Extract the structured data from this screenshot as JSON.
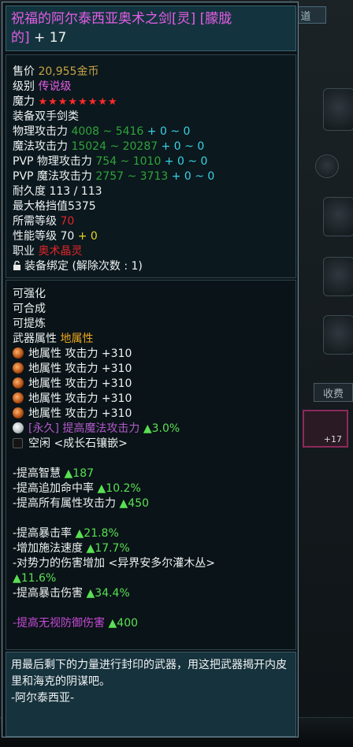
{
  "background": {
    "top_button": "道",
    "charge_button": "收费",
    "item_plus": "+17"
  },
  "title": {
    "line1": "祝福的阿尔泰西亚奥术之剑[灵] [朦胧",
    "line2": "的]",
    "enhance": " + 17"
  },
  "basic": {
    "price_label": "售价 ",
    "price_value": "20,955",
    "price_unit": "金币",
    "level_label": "级别 ",
    "level_value": "传说级",
    "magic_label": "魔力 ",
    "magic_stars": "★★★★★★★★",
    "equip_label": "装备",
    "equip_value": "双手剑类",
    "phys_label": "物理攻击力 ",
    "phys_value": "4008 ~ 5416",
    "phys_bonus": " + 0 ~ 0",
    "mag_label": "魔法攻击力 ",
    "mag_value": "15024 ~ 20287",
    "mag_bonus": " + 0 ~ 0",
    "pvp_phys_label": "PVP 物理攻击力 ",
    "pvp_phys_value": "754 ~ 1010",
    "pvp_phys_bonus": " + 0 ~ 0",
    "pvp_mag_label": "PVP 魔法攻击力 ",
    "pvp_mag_value": "2757 ~ 3713",
    "pvp_mag_bonus": " + 0 ~ 0",
    "durability": "耐久度 113 / 113",
    "max_block": "最大格挡值5375",
    "req_level_label": "所需等级 ",
    "req_level_value": "70",
    "perf_label": "性能等级 ",
    "perf_value": "70",
    "perf_bonus": " + 0",
    "job_label": "职业 ",
    "job_value": "奥术晶灵",
    "bind_text": "装备绑定 (解除次数 : 1)"
  },
  "options": {
    "can_enhance": "可强化",
    "can_combine": "可合成",
    "can_refine": "可提炼",
    "attr_label": "武器属性 ",
    "attr_value": "地属性",
    "earth_attack": [
      "地属性 攻击力 +310",
      "地属性 攻击力 +310",
      "地属性 攻击力 +310",
      "地属性 攻击力 +310",
      "地属性 攻击力 +310"
    ],
    "perm_label": "[永久] 提高魔法攻击力 ",
    "perm_value": "▲3.0%",
    "empty_slot": "空闲 <成长石镶嵌>"
  },
  "bonuses": {
    "wisdom_label": "-提高智慧 ",
    "wisdom_value": "▲187",
    "hit_label": "-提高追加命中率 ",
    "hit_value": "▲10.2%",
    "allattr_label": "-提高所有属性攻击力 ",
    "allattr_value": "▲450",
    "crit_label": "-提高暴击率 ",
    "crit_value": "▲21.8%",
    "cast_label": "-增加施法速度 ",
    "cast_value": "▲17.7%",
    "faction_label": "-对势力的伤害增加 <异界安多尔灌木丛>",
    "faction_value": "▲11.6%",
    "critdmg_label": "-提高暴击伤害 ",
    "critdmg_value": "▲34.4%",
    "ignore_label": "-提高无视防御伤害  ",
    "ignore_value": "▲400"
  },
  "description": {
    "text": "用最后剩下的力量进行封印的武器，用这把武器揭开内皮里和海克的阴谋吧。",
    "author": "-阿尔泰西亚-"
  },
  "colors": {
    "title": "#e55de6",
    "gold": "#c7a447",
    "red": "#e0262a",
    "green": "#2fa53a",
    "cyan": "#37d4e6",
    "yellow": "#e4d42c",
    "bright_green": "#59e053"
  }
}
